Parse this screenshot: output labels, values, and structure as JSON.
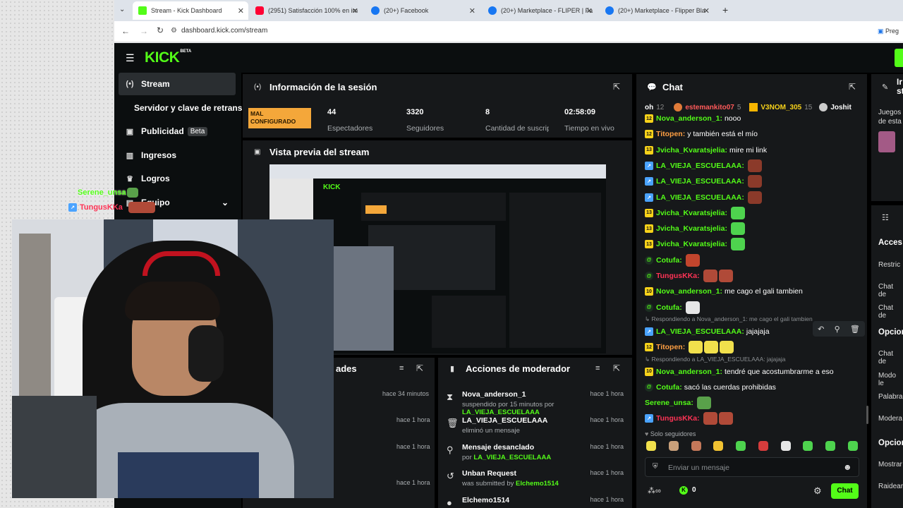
{
  "browser": {
    "tabs": [
      {
        "label": "Stream - Kick Dashboard",
        "color": "#53fc18"
      },
      {
        "label": "(2951) Satisfacción 100% en im",
        "color": "#ff0033"
      },
      {
        "label": "(20+) Facebook",
        "color": "#1877f2"
      },
      {
        "label": "(20+) Marketplace - FLIPER | Fa",
        "color": "#1877f2"
      },
      {
        "label": "(20+) Marketplace - Flipper Bla",
        "color": "#1877f2"
      }
    ],
    "url": "dashboard.kick.com/stream",
    "right_button": "Preg"
  },
  "app": {
    "logo": "KICK",
    "logo_badge": "BETA"
  },
  "sidebar": {
    "items": [
      {
        "label": "Stream",
        "icon": "broadcast-icon"
      },
      {
        "label": "Servidor y clave de retransm",
        "icon": ""
      },
      {
        "label": "Publicidad",
        "badge": "Beta",
        "icon": "ad-icon"
      },
      {
        "label": "Ingresos",
        "icon": "chart-icon"
      },
      {
        "label": "Logros",
        "icon": "trophy-icon"
      },
      {
        "label": "Equipo",
        "icon": "team-icon"
      }
    ]
  },
  "session": {
    "title": "Información de la sesión",
    "status": "MAL CONFIGURADO",
    "stats": [
      {
        "value": "44",
        "label": "Espectadores"
      },
      {
        "value": "3320",
        "label": "Seguidores"
      },
      {
        "value": "8",
        "label": "Cantidad de suscripciones"
      },
      {
        "value": "02:58:09",
        "label": "Tiempo en vivo"
      }
    ]
  },
  "preview": {
    "title": "Vista previa del stream"
  },
  "activity": {
    "title": "ades",
    "times": [
      "hace 34 minutos",
      "hace 1 hora",
      "hace 1 hora",
      "hace 1 hora"
    ]
  },
  "mod_actions": {
    "title": "Acciones de moderador",
    "rows": [
      {
        "name": "Nova_anderson_1",
        "sub": "suspendido por 15 minutos por",
        "by": "LA_VIEJA_ESCUELAAA",
        "time": "hace 1 hora",
        "icon": "hourglass-icon"
      },
      {
        "name": "LA_VIEJA_ESCUELAAA",
        "sub": "eliminó un mensaje",
        "by": "",
        "time": "hace 1 hora",
        "icon": "trash-icon"
      },
      {
        "name": "Mensaje desanclado",
        "sub": "por",
        "by": "LA_VIEJA_ESCUELAAA",
        "time": "hace 1 hora",
        "icon": "unpin-icon"
      },
      {
        "name": "Unban Request",
        "sub": "was submitted by",
        "by": "Elchemo1514",
        "time": "hace 1 hora",
        "icon": "undo-icon"
      },
      {
        "name": "Elchemo1514",
        "sub": "",
        "by": "",
        "time": "hace 1 hora",
        "icon": "user-icon"
      }
    ]
  },
  "chat": {
    "title": "Chat",
    "top_gifters": [
      {
        "name": "oh",
        "count": "12"
      },
      {
        "name": "estemankito07",
        "count": "5"
      },
      {
        "name": "V3NOM_305",
        "count": "15"
      },
      {
        "name": "Joshit",
        "count": ""
      }
    ],
    "messages": [
      {
        "user": "Nova_anderson_1",
        "text": "nooo",
        "color": "#53fc18",
        "badge": "num",
        "emotes": []
      },
      {
        "user": "Titopen",
        "text": "y también está el mío",
        "color": "#ff9f43",
        "badge": "num",
        "emotes": []
      },
      {
        "user": "Jvicha_Kvaratsjelia",
        "text": "mire mi link",
        "color": "#53fc18",
        "badge": "num",
        "emotes": []
      },
      {
        "user": "LA_VIEJA_ESCUELAAA",
        "text": "",
        "color": "#53fc18",
        "badge": "vip",
        "emotes": [
          "#8b3a2a"
        ]
      },
      {
        "user": "LA_VIEJA_ESCUELAAA",
        "text": "",
        "color": "#53fc18",
        "badge": "vip",
        "emotes": [
          "#8b3a2a"
        ]
      },
      {
        "user": "LA_VIEJA_ESCUELAAA",
        "text": "",
        "color": "#53fc18",
        "badge": "vip",
        "emotes": [
          "#8b3a2a"
        ]
      },
      {
        "user": "Jvicha_Kvaratsjelia",
        "text": "",
        "color": "#53fc18",
        "badge": "num",
        "emotes": [
          "#4ed34e"
        ]
      },
      {
        "user": "Jvicha_Kvaratsjelia",
        "text": "",
        "color": "#53fc18",
        "badge": "num",
        "emotes": [
          "#4ed34e"
        ]
      },
      {
        "user": "Jvicha_Kvaratsjelia",
        "text": "",
        "color": "#53fc18",
        "badge": "num",
        "emotes": [
          "#4ed34e"
        ]
      },
      {
        "user": "Cotufa",
        "text": "",
        "color": "#53fc18",
        "badge": "og",
        "emotes": [
          "#c2452d"
        ]
      },
      {
        "user": "TungusKKa",
        "text": "",
        "color": "#ff3355",
        "badge": "og",
        "emotes": [
          "#b04a38",
          "#b04a38"
        ]
      },
      {
        "user": "Nova_anderson_1",
        "text": "me cago el gali tambien",
        "color": "#53fc18",
        "badge": "num",
        "emotes": []
      },
      {
        "user": "Cotufa",
        "text": "",
        "color": "#53fc18",
        "badge": "og",
        "emotes": [
          "#e6e6e6"
        ]
      },
      {
        "user": "LA_VIEJA_ESCUELAAA",
        "text": "jajajaja",
        "color": "#53fc18",
        "badge": "vip",
        "emotes": [],
        "reply": "Respondiendo a Nova_anderson_1: me cago el gali tambien"
      },
      {
        "user": "Titopen",
        "text": "",
        "color": "#ff9f43",
        "badge": "num",
        "emotes": [
          "#f1e04c",
          "#f1e04c",
          "#f1e04c"
        ]
      },
      {
        "user": "Nova_anderson_1",
        "text": "tendré que acostumbrarme a eso",
        "color": "#53fc18",
        "badge": "num",
        "emotes": [],
        "reply": "Respondiendo a LA_VIEJA_ESCUELAAA: jajajaja"
      },
      {
        "user": "Cotufa",
        "text": "sacó las cuerdas prohibidas",
        "color": "#53fc18",
        "badge": "og",
        "emotes": []
      },
      {
        "user": "Serene_unsa",
        "text": "",
        "color": "#53fc18",
        "badge": "",
        "emotes": [
          "#59a14a"
        ]
      },
      {
        "user": "TungusKKa",
        "text": "",
        "color": "#ff3355",
        "badge": "vip",
        "emotes": [
          "#b04a38",
          "#b04a38"
        ]
      }
    ],
    "followers_only": "Solo seguidores",
    "input_placeholder": "Enviar un mensaje",
    "send_label": "Chat",
    "kick_count": "0",
    "badge_nums": [
      "12",
      "12",
      "13",
      "13",
      "13",
      "13",
      "10",
      "12",
      "10"
    ]
  },
  "right_panel": {
    "title": "Ir",
    "title2": "st",
    "juegos": "Juegos de esta",
    "section": "Acces",
    "items1": [
      "Restric",
      "Chat de",
      "Chat de"
    ],
    "section2": "Opcion",
    "items2": [
      "Chat de",
      "Modo le",
      "Palabra",
      "Modera"
    ],
    "section3": "Opcion",
    "items3": [
      "Mostrar",
      "Raidear"
    ]
  },
  "overlay": {
    "user1": "Serene_unsa",
    "user2": "TungusKKa"
  }
}
